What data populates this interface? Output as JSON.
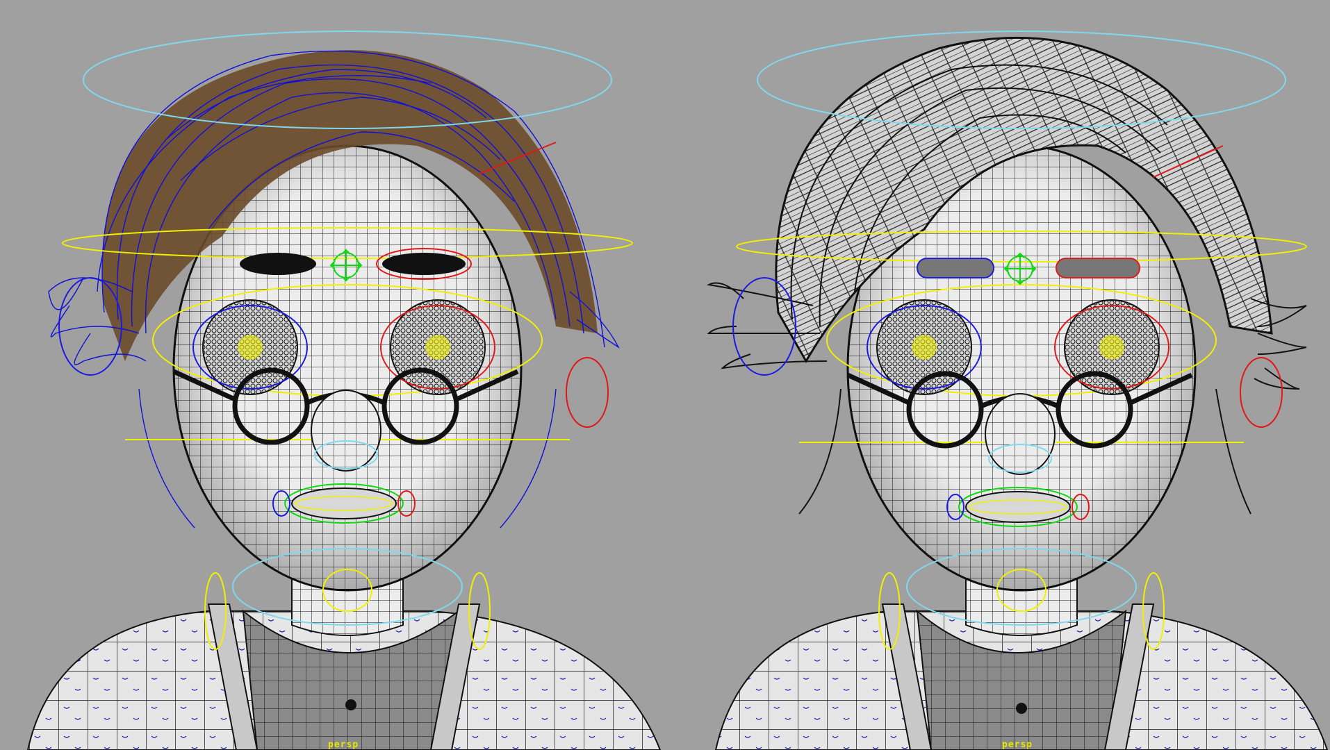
{
  "viewports": [
    {
      "id": "left",
      "camera_label": "persp",
      "hair_display": "strand-curves"
    },
    {
      "id": "right",
      "camera_label": "persp",
      "hair_display": "polygon-cards"
    }
  ],
  "colors": {
    "background": "#a0a0a0",
    "wire": "#111111",
    "control_yellow": "#f0f000",
    "control_cyan": "#7fd8ee",
    "control_red": "#e01818",
    "control_blue": "#1a1ae0",
    "control_green": "#10d810",
    "hair_brown": "#6b4a2a",
    "hair_curves": "#1010d8",
    "selection_bar": "#3a6fe0"
  }
}
